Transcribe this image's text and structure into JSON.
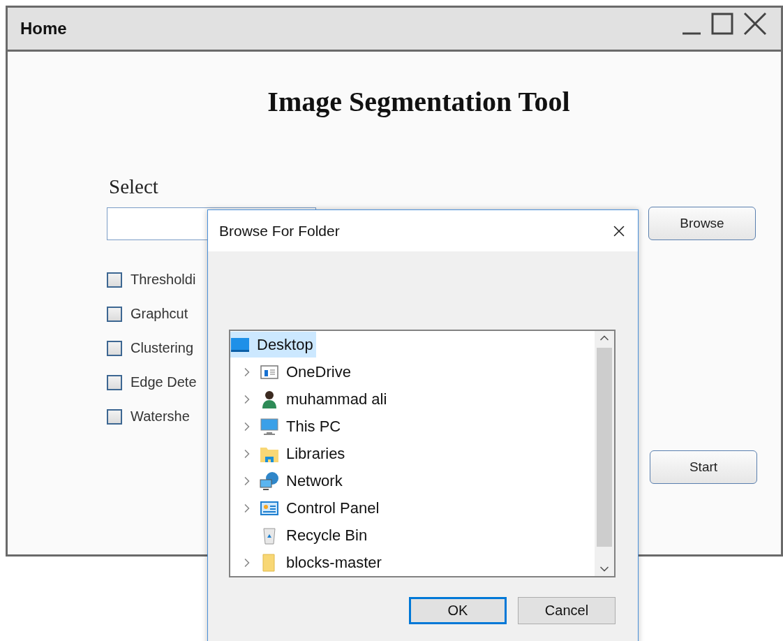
{
  "window": {
    "title": "Home"
  },
  "heading": "Image Segmentation Tool",
  "select": {
    "label": "Select",
    "button": "Browse"
  },
  "methods": [
    {
      "label": "Thresholdi",
      "checked": false
    },
    {
      "label": "Graphcut",
      "checked": false
    },
    {
      "label": "Clustering",
      "checked": false
    },
    {
      "label": "Edge Dete",
      "checked": false
    },
    {
      "label": "Watershe",
      "checked": false
    }
  ],
  "start_button": "Start",
  "dialog": {
    "title": "Browse For Folder",
    "tree": [
      {
        "label": "Desktop",
        "kind": "desktop",
        "selected": true,
        "expandable": false,
        "children": [
          {
            "label": "OneDrive",
            "kind": "cloud-drive",
            "selected": false,
            "expandable": true
          },
          {
            "label": "muhammad ali",
            "kind": "user",
            "selected": false,
            "expandable": true
          },
          {
            "label": "This PC",
            "kind": "computer",
            "selected": false,
            "expandable": true
          },
          {
            "label": "Libraries",
            "kind": "libraries",
            "selected": false,
            "expandable": true
          },
          {
            "label": "Network",
            "kind": "network",
            "selected": false,
            "expandable": true
          },
          {
            "label": "Control Panel",
            "kind": "control-panel",
            "selected": false,
            "expandable": true
          },
          {
            "label": "Recycle Bin",
            "kind": "recycle-bin",
            "selected": false,
            "expandable": false
          },
          {
            "label": "blocks-master",
            "kind": "folder",
            "selected": false,
            "expandable": true
          }
        ]
      }
    ],
    "buttons": [
      {
        "label": "OK",
        "default": true
      },
      {
        "label": "Cancel",
        "default": false
      }
    ]
  }
}
